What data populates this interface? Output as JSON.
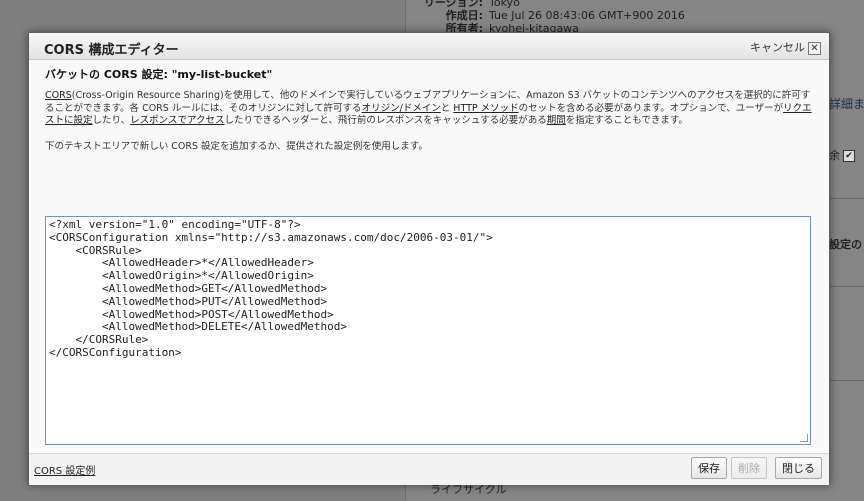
{
  "background": {
    "meta": [
      {
        "key": "リージョン:",
        "value": "Tokyo"
      },
      {
        "key": "作成日:",
        "value": "Tue Jul 26 08:43:06 GMT+900 2016"
      },
      {
        "key": "所有者:",
        "value": "kyohei-kitagawa"
      }
    ],
    "right_link": "詳細ま",
    "right_check_label": "余",
    "right_label": "設定の",
    "bottom_text": "ライフサイクル"
  },
  "dialog": {
    "title": "CORS 構成エディター",
    "close_label": "キャンセル",
    "close_icon": "close-icon",
    "bucket_title": "バケットの CORS 設定: \"my-list-bucket\"",
    "desc": {
      "cors_link": "CORS",
      "part1": "(Cross-Origin Resource Sharing)を使用して、他のドメインで実行しているウェブアプリケーションに、Amazon S3 バケットのコンテンツへのアクセスを選択的に許可することができます。各 CORS ルールには、そのオリジンに対して許可する",
      "origin_link": "オリジン/ドメイン",
      "part2": "と ",
      "http_link": "HTTP メソッド",
      "part3": "のセットを含める必要があります。オプションで、ユーザーが",
      "request_link": "リクエストに設定",
      "part4": "したり、",
      "response_link": "レスポンスでアクセス",
      "part5": "したりできるヘッダーと、飛行前のレスポンスをキャッシュする必要がある",
      "period_link": "期間",
      "part6": "を指定することもできます。"
    },
    "instruction": "下のテキストエリアで新しい CORS 設定を追加するか、提供された設定例を使用します。",
    "editor_lines": [
      "<?xml version=\"1.0\" encoding=\"UTF-8\"?>",
      "<CORSConfiguration xmlns=\"http://s3.amazonaws.com/doc/2006-03-01/\">",
      "    <CORSRule>",
      "        <AllowedHeader>*</AllowedHeader>",
      "        <AllowedOrigin>*</AllowedOrigin>",
      "        <AllowedMethod>GET</AllowedMethod>",
      "        <AllowedMethod>PUT</AllowedMethod>",
      "        <AllowedMethod>POST</AllowedMethod>",
      "        <AllowedMethod>DELETE</AllowedMethod>",
      "    </CORSRule>",
      "</CORSConfiguration>"
    ],
    "footer": {
      "example_link": "CORS 設定例",
      "save": "保存",
      "delete": "削除",
      "close": "閉じる"
    }
  }
}
